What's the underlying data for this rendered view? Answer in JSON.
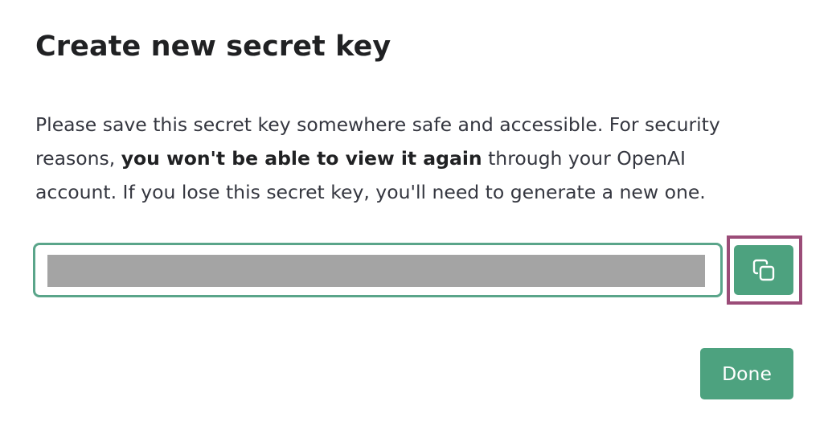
{
  "dialog": {
    "title": "Create new secret key",
    "description": {
      "line1": "Please save this secret key somewhere safe and accessible. For security",
      "line2_before": "reasons, ",
      "line2_bold": "you won't be able to view it again",
      "line2_after": " through your OpenAI",
      "line3": "account. If you lose this secret key, you'll need to generate a new one."
    },
    "key_field": {
      "value": "",
      "redacted": true
    },
    "copy_button": {
      "icon": "copy-icon"
    },
    "done_button": {
      "label": "Done"
    }
  },
  "colors": {
    "accent": "#4da27f",
    "field_border": "#5aa58a",
    "highlight_border": "#9b4c78",
    "redaction": "#a4a4a4",
    "title_text": "#202123",
    "body_text": "#353740"
  }
}
